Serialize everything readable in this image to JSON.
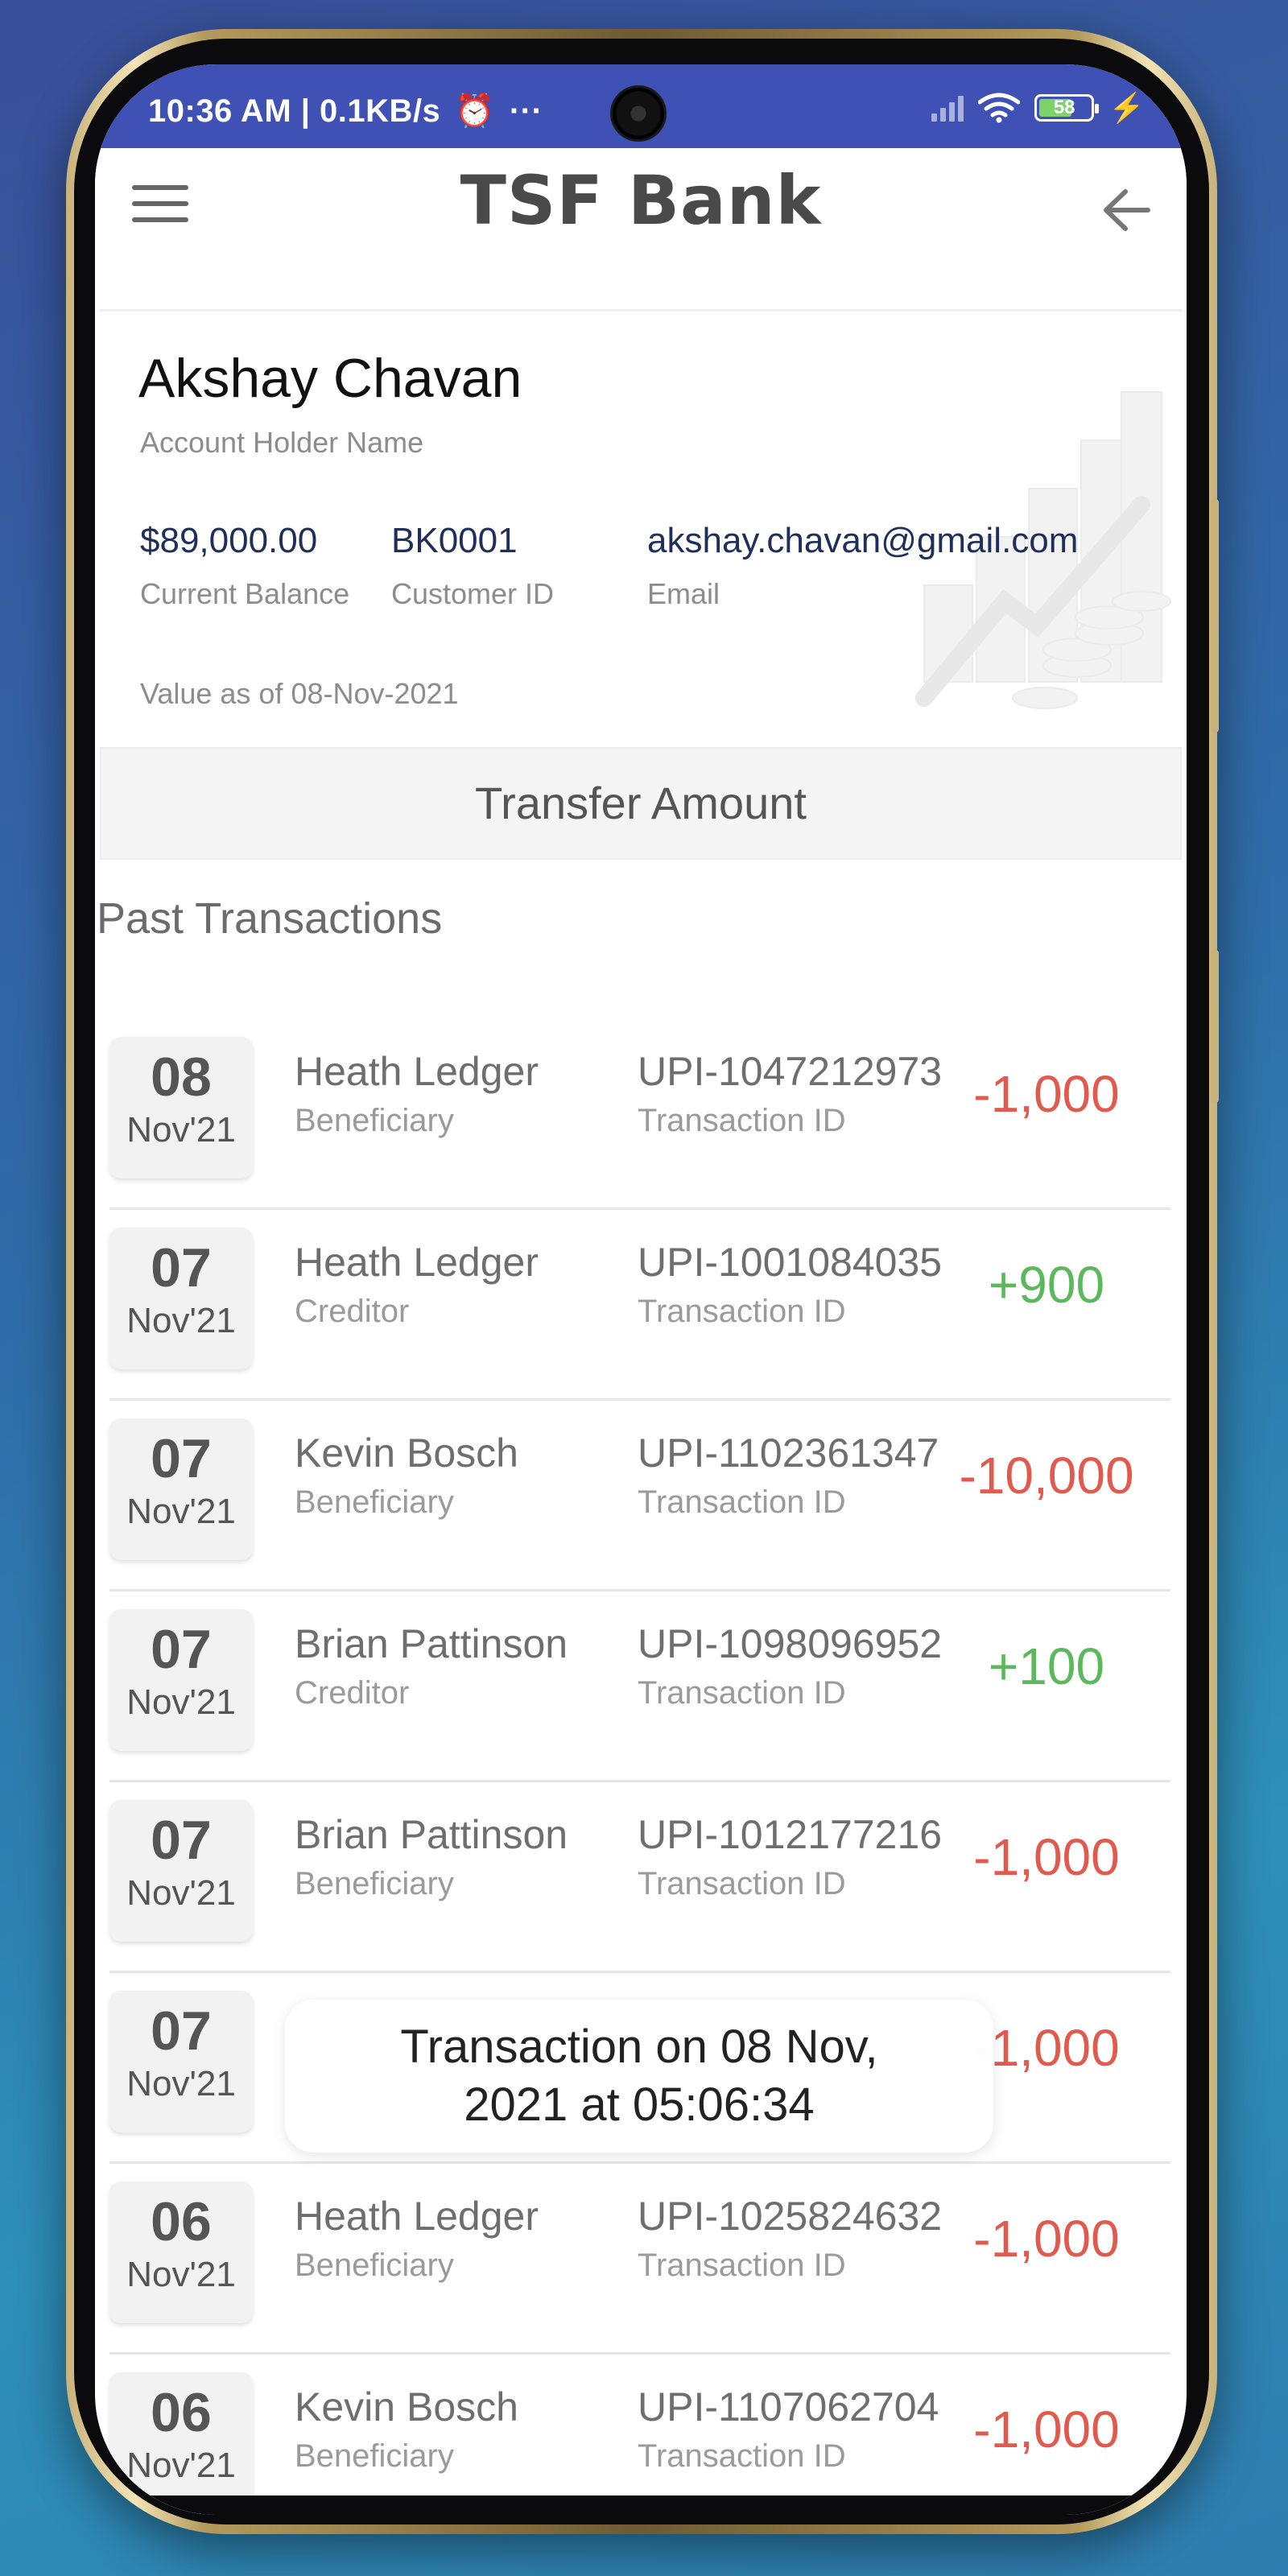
{
  "status_bar": {
    "time_speed": "10:36 AM | 0.1KB/s",
    "alarm_icon": "alarm-clock-icon",
    "more": "···",
    "battery": "58",
    "icons": [
      "signal-icon",
      "wifi-icon",
      "battery-icon",
      "charging-bolt-icon"
    ]
  },
  "app_bar": {
    "title": "TSF Bank",
    "menu_icon": "hamburger-menu-icon",
    "back_icon": "back-arrow-icon"
  },
  "account": {
    "name": "Akshay Chavan",
    "name_label": "Account Holder Name",
    "balance": "$89,000.00",
    "balance_label": "Current Balance",
    "customer_id": "BK0001",
    "customer_id_label": "Customer ID",
    "email": "akshay.chavan@gmail.com",
    "email_label": "Email",
    "value_as_of": "Value as of 08-Nov-2021"
  },
  "transfer_button": "Transfer Amount",
  "past_transactions_title": "Past Transactions",
  "colors": {
    "debit": "#e05a4e",
    "credit": "#5cb85c",
    "statusbar": "#3f51b5"
  },
  "transactions": [
    {
      "day": "08",
      "month": "Nov'21",
      "name": "Heath Ledger",
      "role": "Beneficiary",
      "txid": "UPI-1047212973",
      "txid_label": "Transaction ID",
      "amount": "-1,000",
      "type": "debit"
    },
    {
      "day": "07",
      "month": "Nov'21",
      "name": "Heath Ledger",
      "role": "Creditor",
      "txid": "UPI-1001084035",
      "txid_label": "Transaction ID",
      "amount": "+900",
      "type": "credit"
    },
    {
      "day": "07",
      "month": "Nov'21",
      "name": "Kevin Bosch",
      "role": "Beneficiary",
      "txid": "UPI-1102361347",
      "txid_label": "Transaction ID",
      "amount": "-10,000",
      "type": "debit"
    },
    {
      "day": "07",
      "month": "Nov'21",
      "name": "Brian Pattinson",
      "role": "Creditor",
      "txid": "UPI-1098096952",
      "txid_label": "Transaction ID",
      "amount": "+100",
      "type": "credit"
    },
    {
      "day": "07",
      "month": "Nov'21",
      "name": "Brian Pattinson",
      "role": "Beneficiary",
      "txid": "UPI-1012177216",
      "txid_label": "Transaction ID",
      "amount": "-1,000",
      "type": "debit"
    },
    {
      "day": "07",
      "month": "Nov'21",
      "name": "",
      "role": "",
      "txid": "",
      "txid_label": "",
      "amount": "-1,000",
      "type": "debit"
    },
    {
      "day": "06",
      "month": "Nov'21",
      "name": "Heath Ledger",
      "role": "Beneficiary",
      "txid": "UPI-1025824632",
      "txid_label": "Transaction ID",
      "amount": "-1,000",
      "type": "debit"
    },
    {
      "day": "06",
      "month": "Nov'21",
      "name": "Kevin Bosch",
      "role": "Beneficiary",
      "txid": "UPI-1107062704",
      "txid_label": "Transaction ID",
      "amount": "-1,000",
      "type": "debit"
    }
  ],
  "toast": {
    "line1": "Transaction on 08 Nov,",
    "line2": "2021 at 05:06:34"
  }
}
